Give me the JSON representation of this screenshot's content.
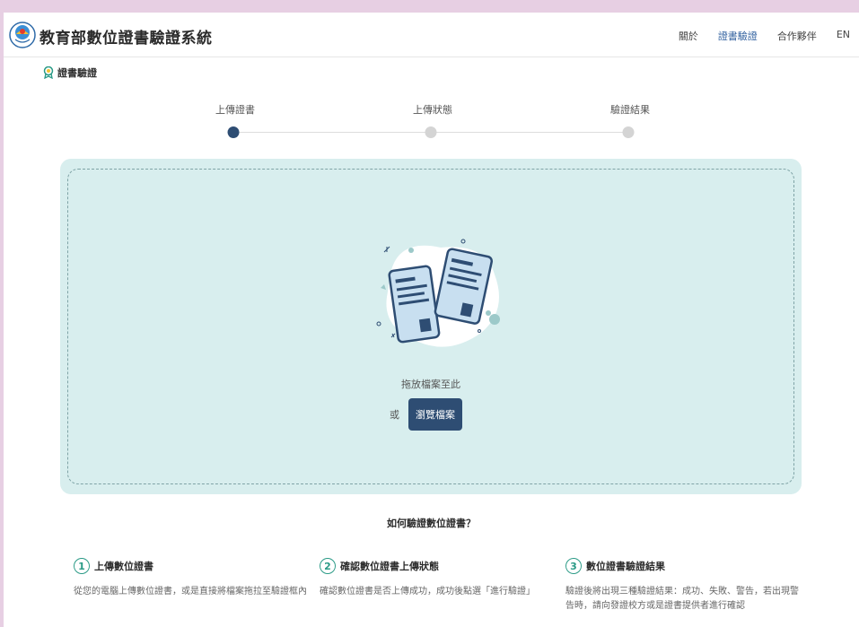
{
  "header": {
    "title": "教育部數位證書驗證系統",
    "nav": [
      "關於",
      "證書驗證",
      "合作夥伴",
      "EN"
    ],
    "active_nav": "證書驗證"
  },
  "section": {
    "title": "證書驗證",
    "icon": "award-icon"
  },
  "steps": {
    "labels": [
      "上傳證書",
      "上傳狀態",
      "驗證結果"
    ],
    "current": 1
  },
  "upload": {
    "drop_text": "拖放檔案至此",
    "or_text": "或",
    "browse_label": "瀏覽檔案"
  },
  "howto": {
    "title": "如何驗證數位證書？",
    "items": [
      {
        "num": "1",
        "title": "上傳數位證書",
        "desc": "從您的電腦上傳數位證書，或是直接將檔案拖拉至驗證框內"
      },
      {
        "num": "2",
        "title": "確認數位證書上傳狀態",
        "desc": "確認數位證書是否上傳成功，成功後點選「進行驗證」"
      },
      {
        "num": "3",
        "title": "數位證書驗證結果",
        "desc": "驗證後將出現三種驗證結果：成功、失敗、警告，若出現警告時，請向發證校方或是證書提供者進行確認"
      }
    ]
  },
  "colors": {
    "accent": "#2e4d73",
    "panel": "#d8eeee",
    "number_ring": "#2a9a86"
  }
}
